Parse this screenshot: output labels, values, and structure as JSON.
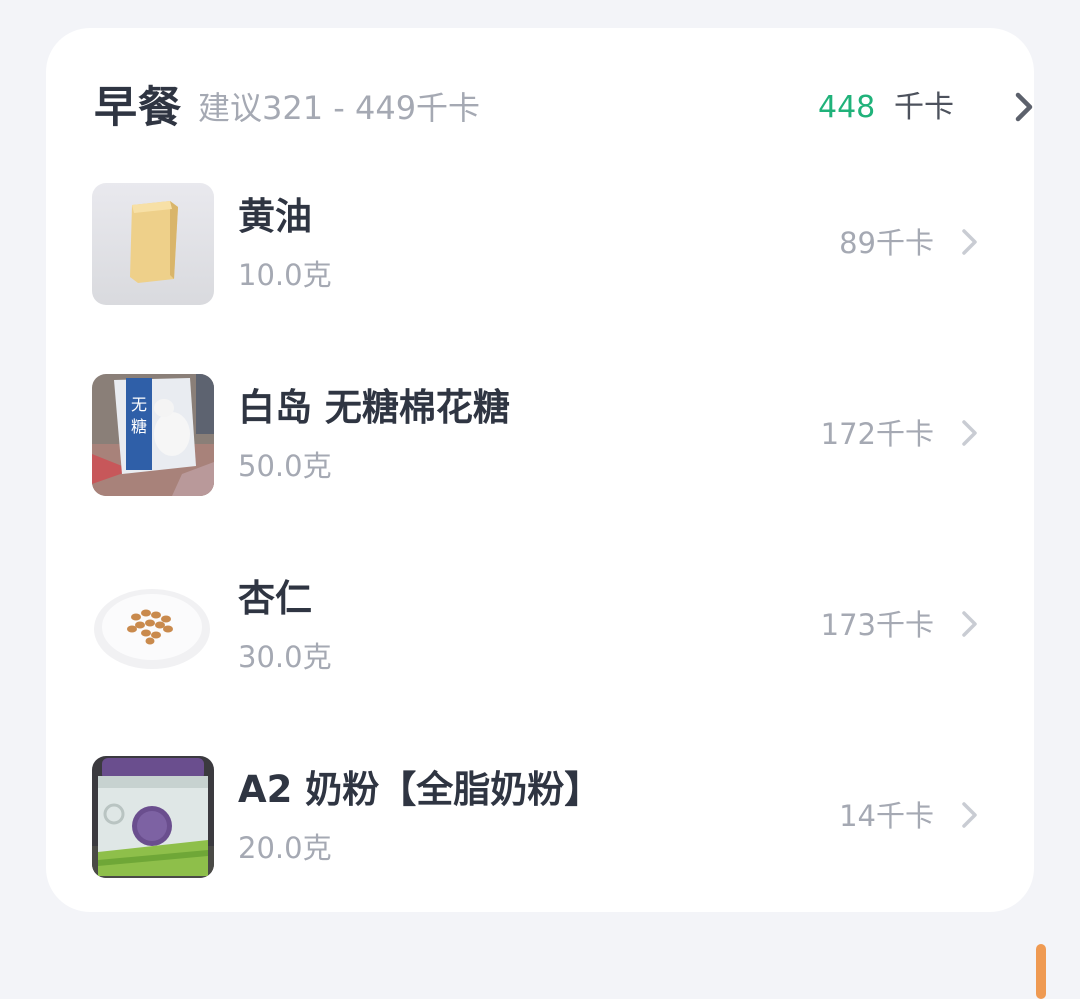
{
  "meal": {
    "title": "早餐",
    "suggestion": "建议321 - 449千卡",
    "total_kcal": "448",
    "total_unit": "千卡",
    "accent_color": "#20b27a"
  },
  "items": [
    {
      "name": "黄油",
      "weight": "10.0克",
      "kcal": "89千卡",
      "thumb_icon": "butter-photo"
    },
    {
      "name": "白岛 无糖棉花糖",
      "weight": "50.0克",
      "kcal": "172千卡",
      "thumb_icon": "marshmallow-bag-photo"
    },
    {
      "name": "杏仁",
      "weight": "30.0克",
      "kcal": "173千卡",
      "thumb_icon": "almonds-plate-photo"
    },
    {
      "name": "A2 奶粉【全脂奶粉】",
      "weight": "20.0克",
      "kcal": "14千卡",
      "thumb_icon": "milk-powder-can-photo"
    }
  ],
  "icons": {
    "chevron": "chevron-right-icon"
  }
}
